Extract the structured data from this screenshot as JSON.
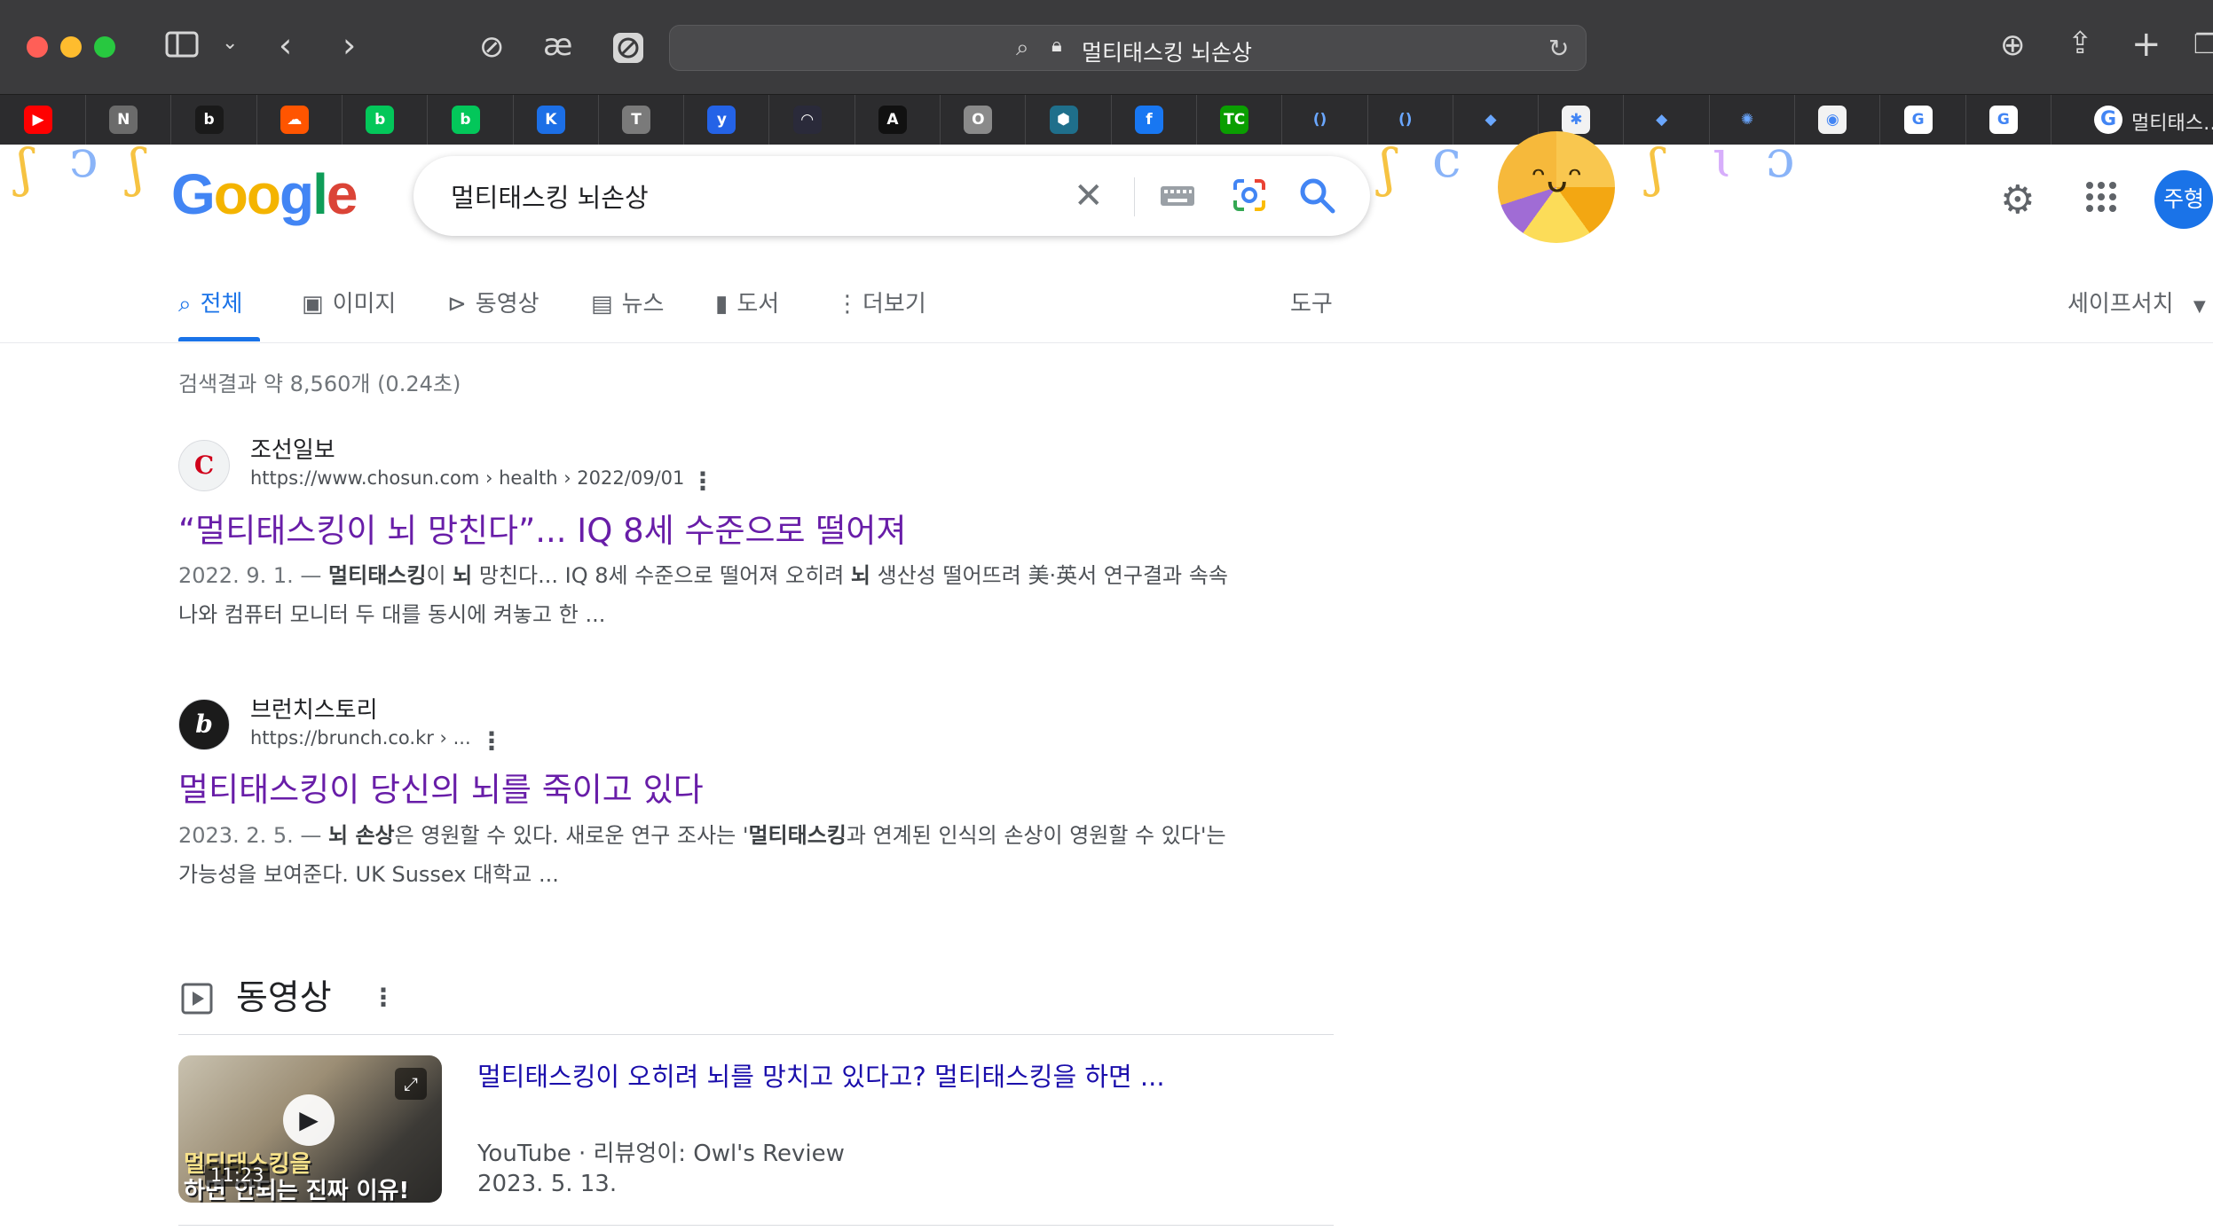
{
  "browser": {
    "url_text": "멀티태스킹 뇌손상",
    "active_tab_title": "멀티태스…",
    "favorites": [
      {
        "icon": "youtube-icon",
        "glyph": "▶",
        "color": "#ff0000"
      },
      {
        "icon": "notion-icon",
        "glyph": "N",
        "color": "#6b6b6b"
      },
      {
        "icon": "brunch-icon",
        "glyph": "b",
        "color": "#1a1a1a"
      },
      {
        "icon": "soundcloud-icon",
        "glyph": "☁",
        "color": "#ff5500"
      },
      {
        "icon": "naver-blog-icon",
        "glyph": "b",
        "color": "#03c75a"
      },
      {
        "icon": "naver-blog-icon",
        "glyph": "b",
        "color": "#03c75a"
      },
      {
        "icon": "k-icon",
        "glyph": "K",
        "color": "#1c6fe6"
      },
      {
        "icon": "t-icon",
        "glyph": "T",
        "color": "#7a7a7a"
      },
      {
        "icon": "yahoo-icon",
        "glyph": "y",
        "color": "#2463e7"
      },
      {
        "icon": "dark-icon",
        "glyph": "◠",
        "color": "#2a2a3a"
      },
      {
        "icon": "a-icon",
        "glyph": "A",
        "color": "#111111"
      },
      {
        "icon": "o-icon",
        "glyph": "O",
        "color": "#8a8a8a"
      },
      {
        "icon": "hex-icon",
        "glyph": "⬢",
        "color": "#1f6f8b"
      },
      {
        "icon": "facebook-icon",
        "glyph": "f",
        "color": "#1877f2"
      },
      {
        "icon": "techcrunch-icon",
        "glyph": "TC",
        "color": "#0a9e01"
      },
      {
        "icon": "paren-icon",
        "glyph": "()",
        "color": "#2c2c2e"
      },
      {
        "icon": "paren-icon",
        "glyph": "()",
        "color": "#2c2c2e"
      },
      {
        "icon": "cloud-blue-icon",
        "glyph": "◆",
        "color": "#2c2c2e"
      },
      {
        "icon": "asterisk-icon",
        "glyph": "✱",
        "color": "#f2f2f2"
      },
      {
        "icon": "cloud-blue-icon",
        "glyph": "◆",
        "color": "#2c2c2e"
      },
      {
        "icon": "openai-icon",
        "glyph": "✺",
        "color": "#2c2c2e"
      },
      {
        "icon": "github-icon",
        "glyph": "◉",
        "color": "#f2f2f2"
      },
      {
        "icon": "google-icon",
        "glyph": "G",
        "color": "#ffffff"
      },
      {
        "icon": "google-icon",
        "glyph": "G",
        "color": "#ffffff"
      }
    ]
  },
  "google": {
    "logo_text": "Google",
    "query": "멀티태스킹 뇌손상",
    "avatar_text": "주형"
  },
  "tabs": {
    "all": "전체",
    "images": "이미지",
    "videos": "동영상",
    "news": "뉴스",
    "books": "도서",
    "more": "더보기",
    "tools": "도구",
    "safesearch": "세이프서치"
  },
  "stats": "검색결과 약 8,560개 (0.24초)",
  "results": [
    {
      "site_name": "조선일보",
      "url": "https://www.chosun.com › health › 2022/09/01",
      "title": "“멀티태스킹이 뇌 망친다”... IQ 8세 수준으로 떨어져",
      "date": "2022. 9. 1. — ",
      "s1": "멀티태스킹",
      "s2": "이 ",
      "s3": "뇌",
      "s4": " 망친다... IQ 8세 수준으로 떨어져 오히려 ",
      "s5": "뇌",
      "s6": " 생산성 떨어뜨려 美·英서 연구결과 속속 나와 컴퓨터 모니터 두 대를 동시에 켜놓고 한 ..."
    },
    {
      "site_name": "브런치스토리",
      "url": "https://brunch.co.kr › ...",
      "title": "멀티태스킹이 당신의 뇌를 죽이고 있다",
      "date": "2023. 2. 5. — ",
      "s1": "뇌 손상",
      "s2": "은 영원할 수 있다. 새로운 연구 조사는 '",
      "s3": "멀티태스킹",
      "s4": "과 연계된 인식의 손상이 영원할 수 있다'는 가능성을 보여준다. UK Sussex 대학교 ..."
    }
  ],
  "videos_section": {
    "title": "동영상",
    "video": {
      "title": "멀티태스킹이 오히려 뇌를 망치고 있다고? 멀티태스킹을 하면 ...",
      "source": "YouTube · 리뷰엉이: Owl's Review",
      "date": "2023. 5. 13.",
      "duration": "11:23",
      "thumb_line1": "멀티태스킹을",
      "thumb_line2": "하면 안되는 진짜 이유!"
    }
  }
}
